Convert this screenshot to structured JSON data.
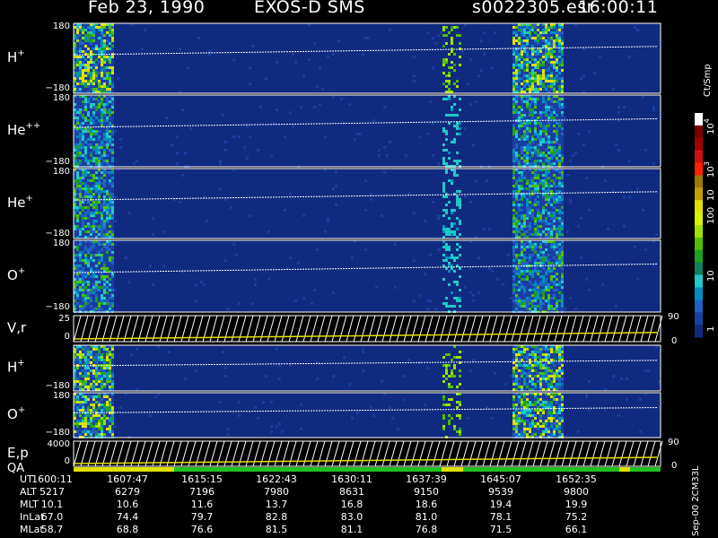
{
  "header": {
    "date": "Feb 23, 1990",
    "mission": "EXOS-D SMS",
    "file": "s0022305.esr",
    "time": "16:00:11"
  },
  "colorbar": {
    "unit": "Ct/Smp",
    "ticks": [
      "10",
      "10",
      "10",
      "100",
      "10",
      "1"
    ],
    "tick_exponents": [
      "4",
      "3",
      "",
      "",
      "",
      ""
    ],
    "colors": [
      "#ffffff",
      "#7a0000",
      "#a00000",
      "#d01010",
      "#ff2000",
      "#9a7a00",
      "#c0a000",
      "#e0e000",
      "#d8f000",
      "#a0e000",
      "#50c000",
      "#20a020",
      "#108060",
      "#20c8c8",
      "#0090c0",
      "#2060c0",
      "#1840a0",
      "#102a80"
    ]
  },
  "footer": {
    "version": "Sep-00 2CM33L"
  },
  "panels": [
    {
      "id": "H+",
      "label": "H",
      "sup": "+",
      "top": "180",
      "bot": "−180"
    },
    {
      "id": "He++",
      "label": "He",
      "sup": "++",
      "top": "180",
      "bot": "−180"
    },
    {
      "id": "He+",
      "label": "He",
      "sup": "+",
      "top": "180",
      "bot": "−180"
    },
    {
      "id": "O+",
      "label": "O",
      "sup": "+",
      "top": "180",
      "bot": "−180"
    },
    {
      "id": "Vr",
      "label": "V,r",
      "sup": "",
      "top": "25",
      "bot": "0",
      "right_top": "90",
      "right_bot": "0"
    },
    {
      "id": "H+2",
      "label": "H",
      "sup": "+",
      "top": "",
      "bot": "−180"
    },
    {
      "id": "O+2",
      "label": "O",
      "sup": "+",
      "top": "180",
      "bot": "−180"
    },
    {
      "id": "Ep",
      "label": "E,p",
      "sup": "",
      "top": "4000",
      "bot": "0",
      "right_top": "90",
      "right_bot": "0"
    }
  ],
  "qa_label": "QA",
  "ephemeris": {
    "rows": [
      {
        "label": "UT",
        "values": [
          "1600:11",
          "1607:47",
          "1615:15",
          "1622:43",
          "1630:11",
          "1637:39",
          "1645:07",
          "1652:35"
        ]
      },
      {
        "label": "ALT",
        "values": [
          "5217",
          "6279",
          "7196",
          "7980",
          "8631",
          "9150",
          "9539",
          "9800"
        ]
      },
      {
        "label": "MLT",
        "values": [
          "10.1",
          "10.6",
          "11.6",
          "13.7",
          "16.8",
          "18.6",
          "19.4",
          "19.9"
        ]
      },
      {
        "label": "InLat",
        "values": [
          "67.0",
          "74.4",
          "79.7",
          "82.8",
          "83.0",
          "81.0",
          "78.1",
          "75.2"
        ]
      },
      {
        "label": "MLat",
        "values": [
          "58.7",
          "68.8",
          "76.6",
          "81.5",
          "81.1",
          "76.8",
          "71.5",
          "66.1"
        ]
      }
    ]
  },
  "chart_data": {
    "type": "heatmap",
    "title": "Feb 23, 1990   EXOS-D SMS",
    "x_ticks_ut": [
      "1600:11",
      "1607:47",
      "1615:15",
      "1622:43",
      "1630:11",
      "1637:39",
      "1645:07",
      "1652:35"
    ],
    "panels": [
      "H+",
      "He++",
      "He+",
      "O+",
      "V,r",
      "H+",
      "O+",
      "E,p"
    ],
    "pitch_angle_range": [
      -180,
      180
    ],
    "colorbar_range": [
      1,
      10000
    ],
    "colorbar_scale": "log",
    "activity_bands_ut": [
      {
        "start": "1600:11",
        "end": "1604:00",
        "level": "high"
      },
      {
        "start": "1637:00",
        "end": "1639:00",
        "level": "medium"
      },
      {
        "start": "1644:00",
        "end": "1649:00",
        "level": "high"
      }
    ]
  }
}
